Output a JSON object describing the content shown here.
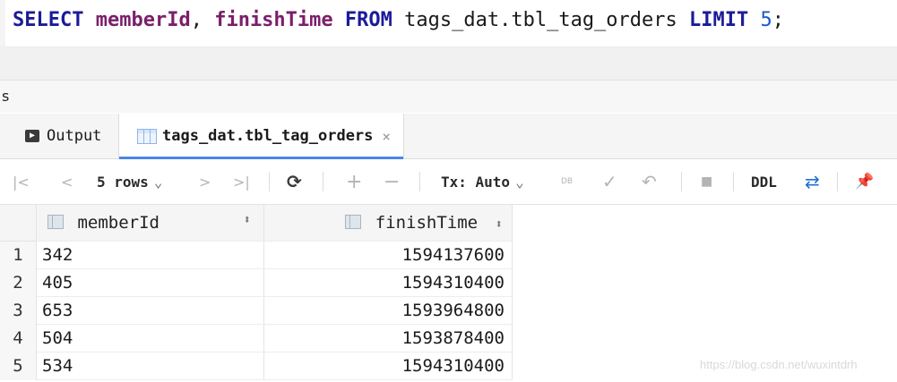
{
  "editor": {
    "tokens": [
      {
        "text": "SELECT",
        "cls": "kw"
      },
      {
        "text": " ",
        "cls": "txt"
      },
      {
        "text": "memberId",
        "cls": "id"
      },
      {
        "text": ", ",
        "cls": "txt"
      },
      {
        "text": "finishTime",
        "cls": "id"
      },
      {
        "text": " ",
        "cls": "txt"
      },
      {
        "text": "FROM",
        "cls": "kw"
      },
      {
        "text": " tags_dat.tbl_tag_orders ",
        "cls": "txt"
      },
      {
        "text": "LIMIT",
        "cls": "kw"
      },
      {
        "text": " ",
        "cls": "txt"
      },
      {
        "text": "5",
        "cls": "num"
      },
      {
        "text": ";",
        "cls": "txt"
      }
    ]
  },
  "services_label": "s",
  "tabs": {
    "output_label": "Output",
    "result_label": "tags_dat.tbl_tag_orders",
    "close_glyph": "×"
  },
  "toolbar": {
    "first_glyph": "|<",
    "prev_glyph": "<",
    "rows_label": "5 rows",
    "rows_caret": "⌄",
    "next_glyph": ">",
    "last_glyph": ">|",
    "refresh_glyph": "⟳",
    "add_glyph": "+",
    "remove_glyph": "−",
    "tx_label": "Tx: Auto",
    "tx_caret": "⌄",
    "db_glyph": "DB",
    "commit_glyph": "✓",
    "rollback_glyph": "↶",
    "stop_glyph": "■",
    "ddl_label": "DDL",
    "compare_glyph": "⇄",
    "pin_glyph": "📌"
  },
  "table": {
    "columns": [
      "memberId",
      "finishTime"
    ],
    "sort_glyph": "⬍",
    "rows": [
      {
        "n": "1",
        "memberId": "342",
        "finishTime": "1594137600"
      },
      {
        "n": "2",
        "memberId": "405",
        "finishTime": "1594310400"
      },
      {
        "n": "3",
        "memberId": "653",
        "finishTime": "1593964800"
      },
      {
        "n": "4",
        "memberId": "504",
        "finishTime": "1593878400"
      },
      {
        "n": "5",
        "memberId": "534",
        "finishTime": "1594310400"
      }
    ]
  },
  "watermark": "https://blog.csdn.net/wuxintdrh",
  "colors": {
    "keyword": "#1b1b99",
    "identifier": "#7a1f6a",
    "number": "#1e57c8",
    "tab_accent": "#4a86e8"
  }
}
